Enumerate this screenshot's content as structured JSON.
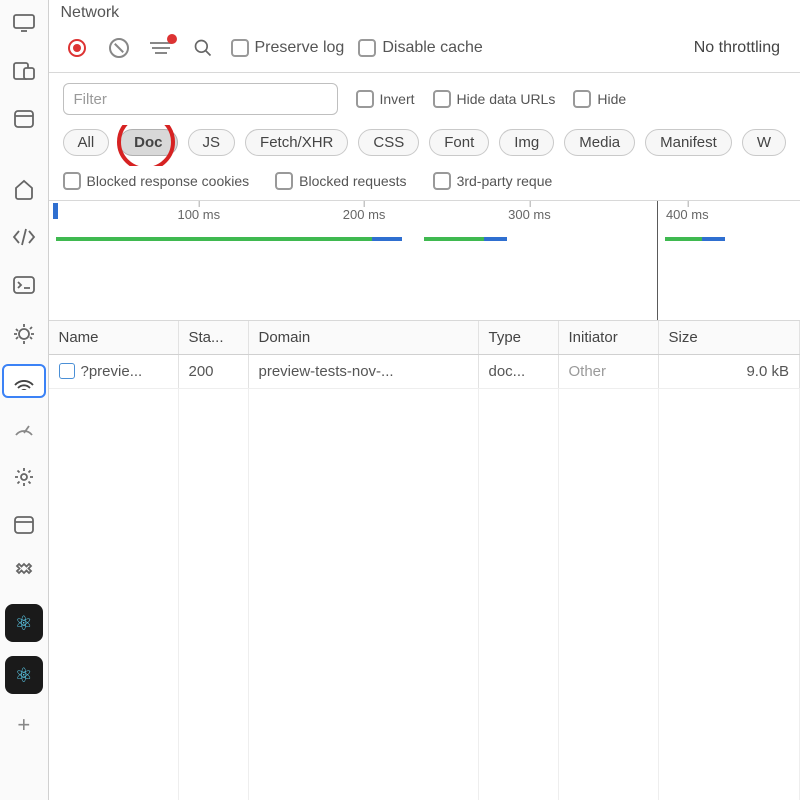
{
  "panel": {
    "title": "Network"
  },
  "toolbar": {
    "preserve_log": "Preserve log",
    "disable_cache": "Disable cache",
    "throttling": "No throttling"
  },
  "filter": {
    "placeholder": "Filter",
    "invert": "Invert",
    "hide_data_urls": "Hide data URLs",
    "hide_ext": "Hide"
  },
  "chips": {
    "all": "All",
    "doc": "Doc",
    "js": "JS",
    "fetch": "Fetch/XHR",
    "css": "CSS",
    "font": "Font",
    "img": "Img",
    "media": "Media",
    "manifest": "Manifest",
    "ws": "W"
  },
  "cookies": {
    "blocked_response": "Blocked response cookies",
    "blocked_requests": "Blocked requests",
    "third_party": "3rd-party reque"
  },
  "timeline": {
    "ticks": [
      "100 ms",
      "200 ms",
      "300 ms",
      "400 ms"
    ]
  },
  "table": {
    "headers": {
      "name": "Name",
      "status": "Sta...",
      "domain": "Domain",
      "type": "Type",
      "initiator": "Initiator",
      "size": "Size"
    },
    "rows": [
      {
        "name": "?previe...",
        "status": "200",
        "domain": "preview-tests-nov-...",
        "type": "doc...",
        "initiator": "Other",
        "size": "9.0 kB"
      }
    ]
  }
}
